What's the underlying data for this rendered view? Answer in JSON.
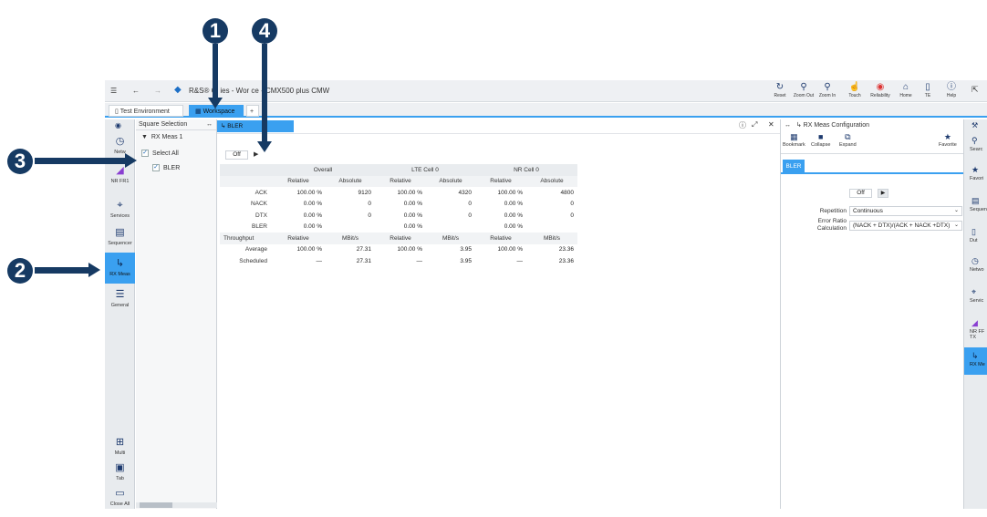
{
  "titlebar": {
    "app_title": "R&S® Cl   ies - Wor     ce - CMX500 plus CMW",
    "tools": [
      {
        "label": "Reset",
        "icon": "reset-icon"
      },
      {
        "label": "Zoom Out",
        "icon": "zoom-out-icon"
      },
      {
        "label": "Zoom In",
        "icon": "zoom-in-icon"
      },
      {
        "label": "Touch",
        "icon": "touch-icon"
      },
      {
        "label": "Reliability",
        "icon": "reliability-icon"
      },
      {
        "label": "Home",
        "icon": "home-icon"
      },
      {
        "label": "TE",
        "icon": "te-icon"
      },
      {
        "label": "Help",
        "icon": "help-icon"
      }
    ]
  },
  "tabs": [
    {
      "label": "Test Environment"
    },
    {
      "label": "Workspace"
    },
    {
      "label": "+"
    }
  ],
  "left_nav": {
    "items": [
      {
        "label": "Netw",
        "icon": "network-icon"
      },
      {
        "label": "NR FR1",
        "icon": "nr-fr1-icon"
      },
      {
        "label": "Services",
        "icon": "services-icon"
      },
      {
        "label": "Sequencer",
        "icon": "sequencer-icon"
      },
      {
        "label": "RX Meas",
        "icon": "rx-meas-icon"
      },
      {
        "label": "General",
        "icon": "general-icon"
      }
    ],
    "bottom": [
      {
        "label": "Multi",
        "icon": "multi-icon"
      },
      {
        "label": "Tab",
        "icon": "tab-icon"
      },
      {
        "label": "Close All",
        "icon": "close-all-icon"
      }
    ]
  },
  "square_selection": {
    "title": "Square Selection",
    "group": "RX Meas 1",
    "select_all": "Select All",
    "item": "BLER"
  },
  "main": {
    "tab_label": "BLER",
    "off_label": "Off",
    "header": [
      "Overall",
      "LTE Cell 0",
      "NR Cell 0"
    ],
    "subheader": [
      "Relative",
      "Absolute",
      "Relative",
      "Absolute",
      "Relative",
      "Absolute"
    ],
    "rows": [
      {
        "label": "ACK",
        "cells": [
          "100.00 %",
          "9120",
          "100.00 %",
          "4320",
          "100.00 %",
          "4800"
        ]
      },
      {
        "label": "NACK",
        "cells": [
          "0.00 %",
          "0",
          "0.00 %",
          "0",
          "0.00 %",
          "0"
        ]
      },
      {
        "label": "DTX",
        "cells": [
          "0.00 %",
          "0",
          "0.00 %",
          "0",
          "0.00 %",
          "0"
        ]
      },
      {
        "label": "BLER",
        "cells": [
          "0.00 %",
          "",
          "0.00 %",
          "",
          "0.00 %",
          ""
        ]
      }
    ],
    "throughput_header": [
      "Throughput",
      "Relative",
      "MBit/s",
      "Relative",
      "MBit/s",
      "Relative",
      "MBit/s"
    ],
    "throughput_rows": [
      {
        "label": "Average",
        "cells": [
          "100.00 %",
          "27.31",
          "100.00 %",
          "3.95",
          "100.00 %",
          "23.36"
        ]
      },
      {
        "label": "Scheduled",
        "cells": [
          "—",
          "27.31",
          "—",
          "3.95",
          "—",
          "23.36"
        ]
      }
    ]
  },
  "config": {
    "title": "RX Meas Configuration",
    "tools": [
      "Bookmark",
      "Collapse",
      "Expand"
    ],
    "favorite": "Favorite",
    "tab": "BLER",
    "off_label": "Off",
    "repetition_label": "Repetition",
    "repetition_value": "Continuous",
    "error_ratio_label_1": "Error Ratio",
    "error_ratio_label_2": "Calculation",
    "error_ratio_value": "(NACK + DTX)/(ACK + NACK +DTX)"
  },
  "right_nav": {
    "items": [
      {
        "label": "Searc",
        "icon": "search-icon"
      },
      {
        "label": "Favori",
        "icon": "star-icon"
      },
      {
        "label": "Sequen",
        "icon": "sequencer-icon"
      },
      {
        "label": "Dut",
        "icon": "dut-icon"
      },
      {
        "label": "Netwo",
        "icon": "network-icon"
      },
      {
        "label": "Servic",
        "icon": "services-icon"
      },
      {
        "label": "NR FF TX",
        "icon": "nr-fr1-icon"
      },
      {
        "label": "RX Me",
        "icon": "rx-meas-icon"
      }
    ]
  },
  "callouts": [
    "1",
    "4",
    "3",
    "2"
  ]
}
